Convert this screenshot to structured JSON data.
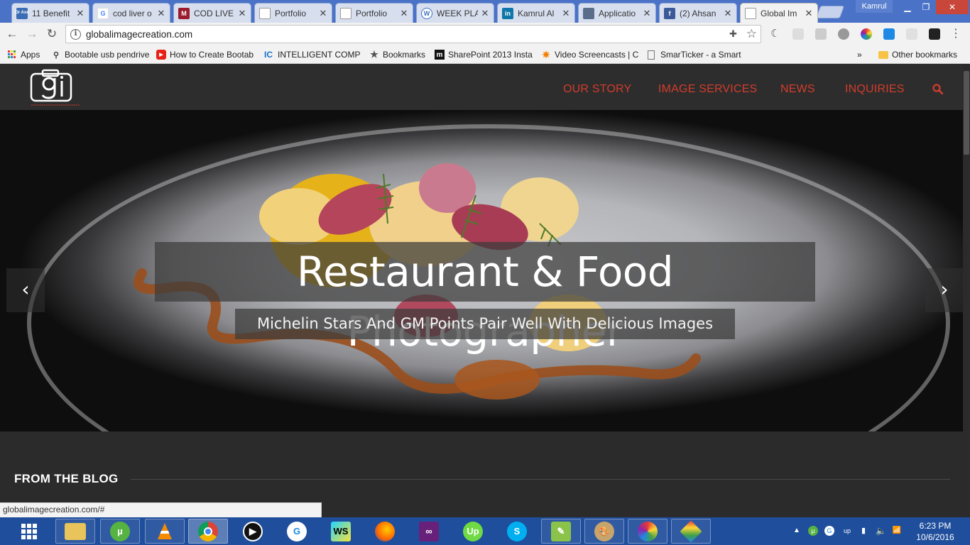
{
  "browser": {
    "tabs": [
      {
        "title": "11 Benefit",
        "favicon": "Dr Axe",
        "favicon_color": "#3a6db3"
      },
      {
        "title": "cod liver o",
        "favicon": "G",
        "favicon_color": "#ffffff"
      },
      {
        "title": "COD LIVE",
        "favicon": "M",
        "favicon_color": "#9b1c2c"
      },
      {
        "title": "Portfolio",
        "favicon": "",
        "favicon_color": "#ffffff"
      },
      {
        "title": "Portfolio",
        "favicon": "",
        "favicon_color": "#ffffff"
      },
      {
        "title": "WEEK PLA",
        "favicon": "W",
        "favicon_color": "#3b6fc4"
      },
      {
        "title": "Kamrul Al",
        "favicon": "in",
        "favicon_color": "#0e76a8"
      },
      {
        "title": "Applicatio",
        "favicon": "",
        "favicon_color": "#5a6e8c"
      },
      {
        "title": "(2) Ahsan",
        "favicon": "f",
        "favicon_color": "#3b5998"
      },
      {
        "title": "Global Im",
        "favicon": "",
        "favicon_color": "#ffffff"
      }
    ],
    "user": "Kamrul",
    "url": "globalimagecreation.com"
  },
  "bookmarks": [
    {
      "label": "Apps",
      "icon": "apps-grid-icon"
    },
    {
      "label": "Bootable usb pendrive",
      "icon": "usb-icon"
    },
    {
      "label": "How to Create Bootab",
      "icon": "youtube-icon"
    },
    {
      "label": "INTELLIGENT COMPUT",
      "icon": "IC"
    },
    {
      "label": "Bookmarks",
      "icon": "star-icon"
    },
    {
      "label": "SharePoint 2013 Insta",
      "icon": "m"
    },
    {
      "label": "Video Screencasts | C",
      "icon": "sun-icon"
    },
    {
      "label": "SmarTicker - a Smart",
      "icon": "page-icon"
    },
    {
      "label": "»",
      "icon": ""
    },
    {
      "label": "Other bookmarks",
      "icon": "folder-icon"
    }
  ],
  "site": {
    "nav": [
      "OUR STORY",
      "IMAGE SERVICES",
      "NEWS",
      "INQUIRIES"
    ],
    "brand_color": "#d33c2c",
    "hero": {
      "title": "Restaurant & Food Photographer",
      "subtitle": "Michelin Stars And GM Points Pair Well With Delicious Images",
      "prev": "‹",
      "next": "›"
    },
    "blog_heading": "FROM THE BLOG"
  },
  "status_url": "globalimagecreation.com/#",
  "taskbar": {
    "time": "6:23 PM",
    "date": "10/6/2016"
  }
}
